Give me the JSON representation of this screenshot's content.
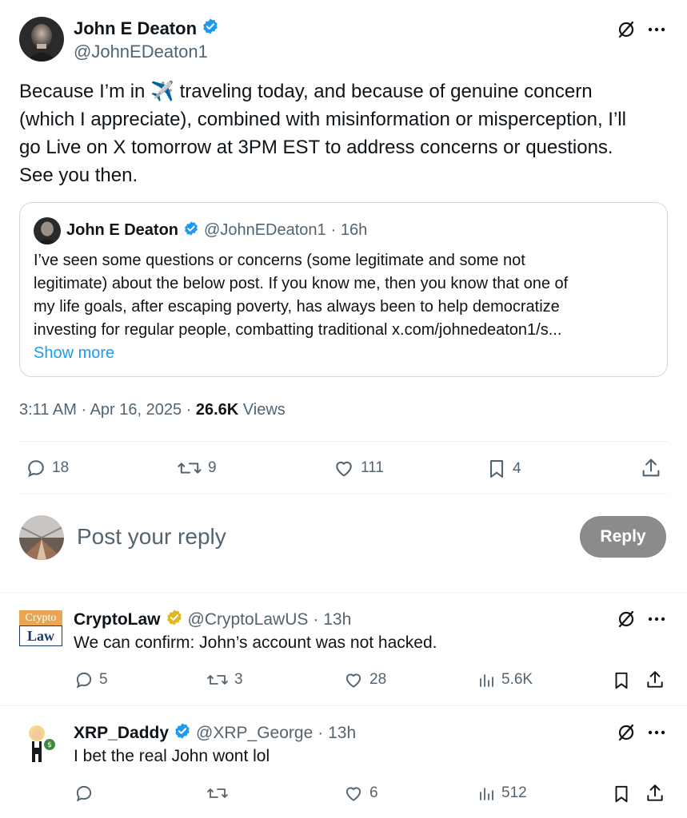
{
  "tweet": {
    "author_name": "John E Deaton",
    "author_handle": "@JohnEDeaton1",
    "text_part1": "Because I’m in",
    "emoji": "✈️",
    "text_part2": "traveling today, and because of genuine concern",
    "text_line2": "(which I appreciate), combined with misinformation or misperception, I’ll",
    "text_line3": "go Live on X tomorrow at 3PM EST to address concerns or questions.",
    "text_line4": "See you then.",
    "timestamp": "3:11 AM · Apr 16, 2025 · ",
    "views_count": "26.6K",
    "views_label": " Views",
    "stats": {
      "replies": "18",
      "reposts": "9",
      "likes": "111",
      "bookmarks": "4"
    }
  },
  "quote": {
    "author_name": "John E Deaton",
    "author_handle": "@JohnEDeaton1",
    "time": "· 16h",
    "line1": "I’ve seen some questions or concerns (some legitimate and some not",
    "line2": "legitimate) about the below post. If you know me, then you know that one of",
    "line3": "my life goals, after escaping poverty, has always been to help democratize",
    "line4": "investing for regular people, combatting traditional x.com/johnedeaton1/s...",
    "show_more": "Show more"
  },
  "composer": {
    "placeholder": "Post your reply",
    "reply_button": "Reply"
  },
  "replies": [
    {
      "name": "CryptoLaw",
      "handle": "@CryptoLawUS",
      "time": "· 13h",
      "text": "We can confirm: John’s account was not hacked.",
      "avatar_top": "Crypto",
      "avatar_bottom": "Law",
      "replies": "5",
      "reposts": "3",
      "likes": "28",
      "views": "5.6K"
    },
    {
      "name": "XRP_Daddy",
      "handle": "@XRP_George",
      "time": "· 13h",
      "text": "I bet the real John wont lol",
      "replies": "",
      "reposts": "",
      "likes": "6",
      "views": "512"
    }
  ],
  "colors": {
    "accent": "#1d9bf0",
    "muted": "#536471",
    "gold_badge": "#e2b719"
  }
}
